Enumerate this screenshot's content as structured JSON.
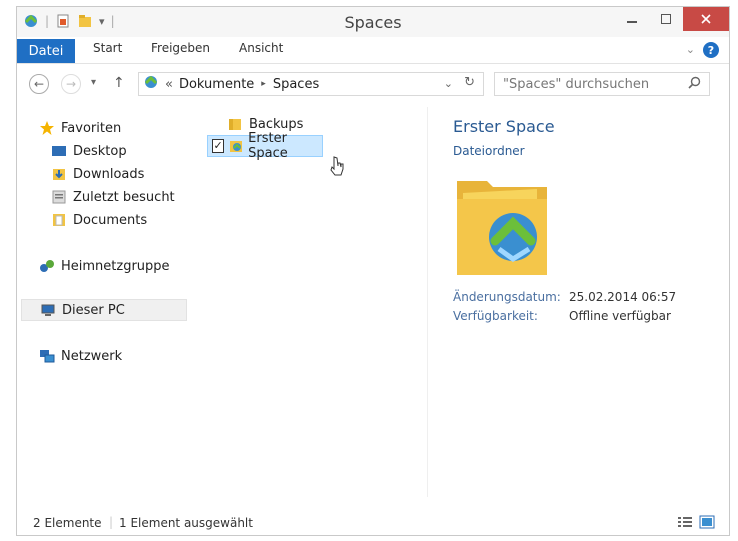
{
  "window": {
    "title": "Spaces"
  },
  "ribbon": {
    "tabs": [
      "Datei",
      "Start",
      "Freigeben",
      "Ansicht"
    ],
    "help_label": "?"
  },
  "address": {
    "prefix": "«",
    "crumbs": [
      "Dokumente",
      "Spaces"
    ],
    "search_placeholder": "\"Spaces\" durchsuchen"
  },
  "nav": {
    "favorites_label": "Favoriten",
    "favorites": [
      "Desktop",
      "Downloads",
      "Zuletzt besucht",
      "Documents"
    ],
    "homegroup_label": "Heimnetzgruppe",
    "pc_label": "Dieser PC",
    "network_label": "Netzwerk"
  },
  "files": [
    {
      "name": "Backups"
    },
    {
      "name": "Erster Space",
      "selected": true
    }
  ],
  "preview": {
    "name": "Erster Space",
    "type": "Dateiordner",
    "modified_label": "Änderungsdatum:",
    "modified_value": "25.02.2014 06:57",
    "availability_label": "Verfügbarkeit:",
    "availability_value": "Offline verfügbar"
  },
  "status": {
    "count": "2 Elemente",
    "selected": "1 Element ausgewählt"
  },
  "colors": {
    "accent": "#1f6fc4",
    "close": "#c84a45",
    "selection": "#cce8ff"
  }
}
